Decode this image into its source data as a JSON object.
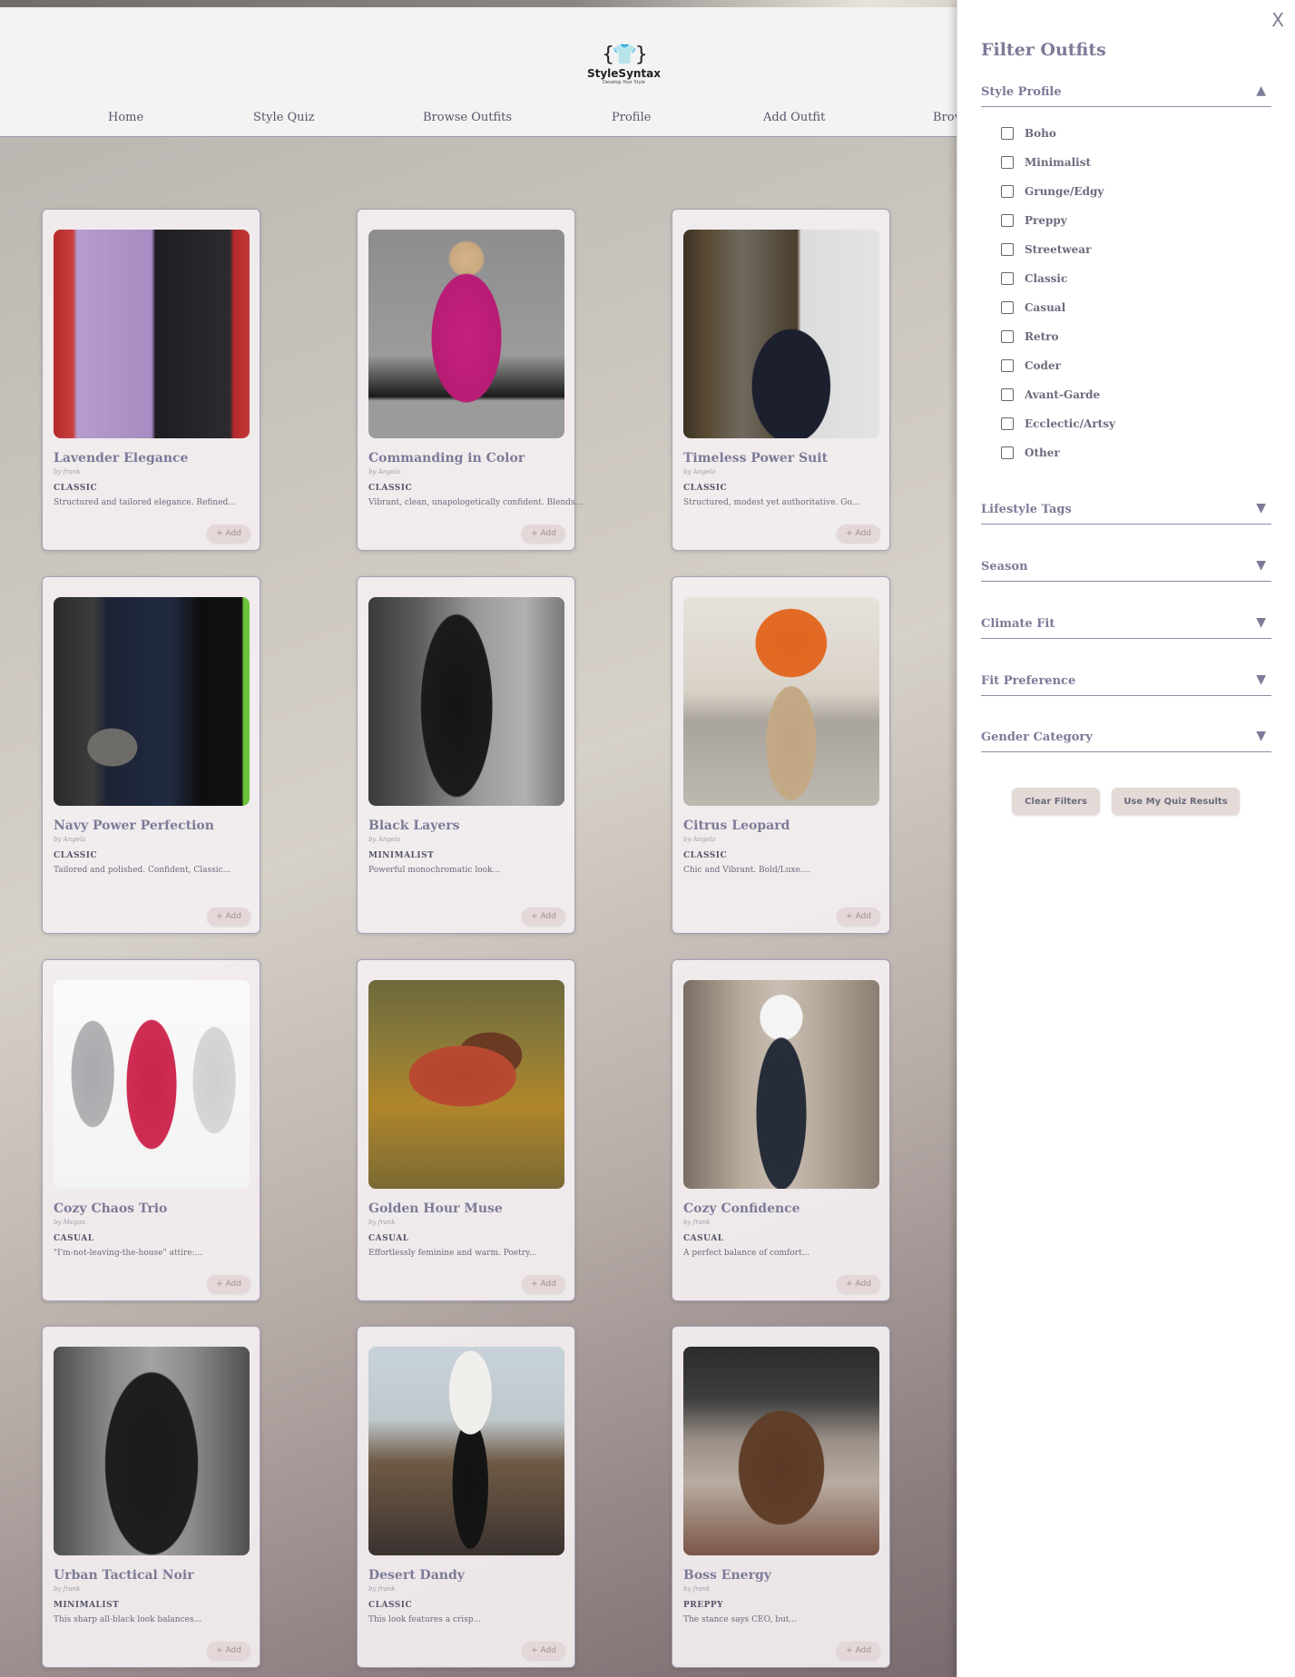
{
  "header": {
    "logo_mark": "{👕}",
    "logo_name": "StyleSyntax",
    "logo_tagline": "Develop Your Style",
    "nav": [
      "Home",
      "Style Quiz",
      "Browse Outfits",
      "Profile",
      "Add Outfit",
      "Brow"
    ]
  },
  "cards": [
    {
      "title": "Lavender Elegance",
      "author": "by frank",
      "style": "CLASSIC",
      "desc": "Structured and tailored elegance. Refined...",
      "add": "+ Add"
    },
    {
      "title": "Commanding in Color",
      "author": "by Angela",
      "style": "CLASSIC",
      "desc": "Vibrant, clean, unapologetically confident. Blends...",
      "add": "+ Add"
    },
    {
      "title": "Timeless Power Suit",
      "author": "by Angela",
      "style": "CLASSIC",
      "desc": "Structured, modest yet authoritative. Go...",
      "add": "+ Add"
    },
    {
      "title": "Navy Power Perfection",
      "author": "by Angela",
      "style": "CLASSIC",
      "desc": "Tailored and polished. Confident, Classic...",
      "add": "+ Add"
    },
    {
      "title": "Black Layers",
      "author": "by Angela",
      "style": "MINIMALIST",
      "desc": "Powerful monochromatic look...",
      "add": "+ Add"
    },
    {
      "title": "Citrus Leopard",
      "author": "by Angela",
      "style": "CLASSIC",
      "desc": "Chic and Vibrant. Bold/Luxe....",
      "add": "+ Add"
    },
    {
      "title": "Cozy Chaos Trio",
      "author": "by Megan",
      "style": "CASUAL",
      "desc": "\"I'm-not-leaving-the-house\" attire:...",
      "add": "+ Add"
    },
    {
      "title": "Golden Hour Muse",
      "author": "by frank",
      "style": "CASUAL",
      "desc": "Effortlessly feminine and warm. Poetry...",
      "add": "+ Add"
    },
    {
      "title": "Cozy Confidence",
      "author": "by frank",
      "style": "CASUAL",
      "desc": "A perfect balance of comfort...",
      "add": "+ Add"
    },
    {
      "title": "Urban Tactical Noir",
      "author": "by frank",
      "style": "MINIMALIST",
      "desc": "This sharp all-black look balances...",
      "add": "+ Add"
    },
    {
      "title": "Desert Dandy",
      "author": "by frank",
      "style": "CLASSIC",
      "desc": "This look features a crisp...",
      "add": "+ Add"
    },
    {
      "title": "Boss Energy",
      "author": "by frank",
      "style": "PREPPY",
      "desc": "The stance says CEO, but...",
      "add": "+ Add"
    }
  ],
  "filter": {
    "close": "X",
    "title": "Filter Outfits",
    "style_profile": {
      "label": "Style Profile",
      "chevron": "▲",
      "options": [
        "Boho",
        "Minimalist",
        "Grunge/Edgy",
        "Preppy",
        "Streetwear",
        "Classic",
        "Casual",
        "Retro",
        "Coder",
        "Avant-Garde",
        "Ecclectic/Artsy",
        "Other"
      ]
    },
    "sections": [
      {
        "label": "Lifestyle Tags",
        "chevron": "▼"
      },
      {
        "label": "Season",
        "chevron": "▼"
      },
      {
        "label": "Climate Fit",
        "chevron": "▼"
      },
      {
        "label": "Fit Preference",
        "chevron": "▼"
      },
      {
        "label": "Gender Category",
        "chevron": "▼"
      }
    ],
    "clear_label": "Clear Filters",
    "quiz_label": "Use My Quiz Results"
  }
}
